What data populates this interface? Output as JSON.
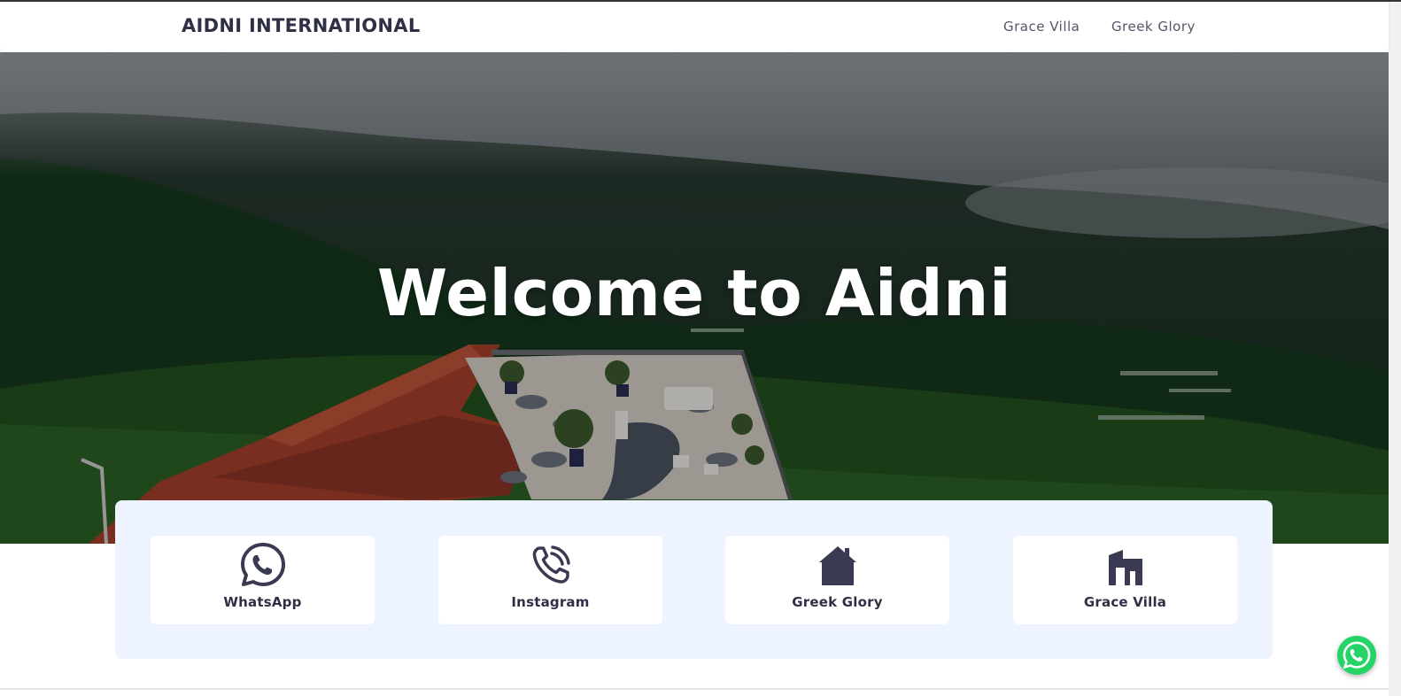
{
  "navbar": {
    "brand": "AIDNI INTERNATIONAL",
    "links": [
      "Grace Villa",
      "Greek Glory"
    ]
  },
  "hero": {
    "title": "Welcome to Aidni"
  },
  "cards": [
    {
      "label": "WhatsApp",
      "icon": "whatsapp-icon"
    },
    {
      "label": "Instagram",
      "icon": "phone-call-icon"
    },
    {
      "label": "Greek Glory",
      "icon": "house-icon"
    },
    {
      "label": "Grace Villa",
      "icon": "building-icon"
    }
  ],
  "floating_button": {
    "icon": "whatsapp-icon"
  },
  "colors": {
    "text_dark": "#2f2f46",
    "panel_bg": "#eef4ff",
    "whatsapp_green": "#25d366",
    "roof_red": "#b3442f"
  }
}
